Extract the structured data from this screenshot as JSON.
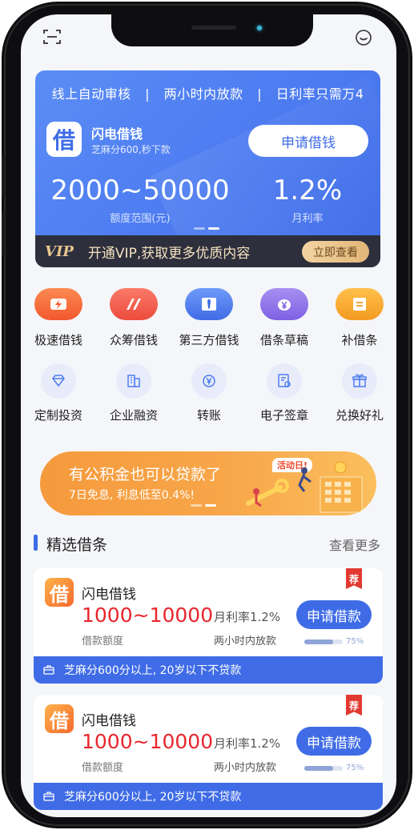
{
  "status_bar": {
    "left_icon": "scan-icon",
    "right_icon": "smile-face-icon"
  },
  "hero": {
    "features": [
      "线上自动审核",
      "两小时内放款",
      "日利率只需万4"
    ],
    "separator": "|",
    "app_logo_char": "借",
    "app_name": "闪电借钱",
    "app_sub": "芝麻分600,秒下款",
    "apply_label": "申请借钱",
    "range_value": "2000~50000",
    "range_label": "额度范围(元)",
    "rate_value": "1.2%",
    "rate_label": "月利率"
  },
  "vip": {
    "badge": "VIP",
    "text": "开通VIP,获取更多优质内容",
    "button": "立即查看"
  },
  "grid_row1": [
    {
      "label": "极速借钱",
      "icon": "lightning-icon",
      "color": "#f26a38"
    },
    {
      "label": "众筹借钱",
      "icon": "crowdfund-icon",
      "color": "#f05a4a"
    },
    {
      "label": "第三方借钱",
      "icon": "tie-icon",
      "color": "#4d7cf1"
    },
    {
      "label": "借条草稿",
      "icon": "yen-bag-icon",
      "color": "#8e72e8"
    },
    {
      "label": "补借条",
      "icon": "note-icon",
      "color": "#f6a63a"
    }
  ],
  "grid_row2": [
    {
      "label": "定制投资",
      "icon": "diamond-icon"
    },
    {
      "label": "企业融资",
      "icon": "building-icon"
    },
    {
      "label": "转账",
      "icon": "transfer-yen-icon"
    },
    {
      "label": "电子签章",
      "icon": "stamp-document-icon"
    },
    {
      "label": "兑换好礼",
      "icon": "gift-icon"
    }
  ],
  "promo": {
    "title": "有公积金也可以贷款了",
    "subtitle": "7日免息, 利息低至0.4%!",
    "tag": "活动日!"
  },
  "section": {
    "title": "精选借条",
    "more": "查看更多"
  },
  "loans": [
    {
      "logo_char": "借",
      "name": "闪电借钱",
      "amount": "1000~10000",
      "amount_label": "借款额度",
      "rate": "月利率1.2%",
      "speed": "两小时内放款",
      "button": "申请借款",
      "progress": 0.75,
      "progress_label": "75%",
      "badge": "荐",
      "requirement": "芝麻分600分以上, 20岁以下不贷款"
    },
    {
      "logo_char": "借",
      "name": "闪电借钱",
      "amount": "1000~10000",
      "amount_label": "借款额度",
      "rate": "月利率1.2%",
      "speed": "两小时内放款",
      "button": "申请借款",
      "progress": 0.75,
      "progress_label": "75%",
      "badge": "荐",
      "requirement": "芝麻分600分以上, 20岁以下不贷款"
    }
  ]
}
